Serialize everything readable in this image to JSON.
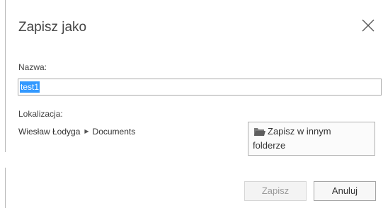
{
  "dialog": {
    "title": "Zapisz jako",
    "close_icon": "close-icon"
  },
  "name": {
    "label": "Nazwa:",
    "value": "test1",
    "selected": true
  },
  "location": {
    "label": "Lokalizacja:",
    "breadcrumb": [
      "Wiesław Łodyga",
      "Documents"
    ],
    "separator_icon": "chevron-right-icon"
  },
  "browse_button": {
    "icon": "folder-open-icon",
    "line1": "Zapisz w innym",
    "line2": "folderze"
  },
  "footer": {
    "save_label": "Zapisz",
    "save_enabled": false,
    "cancel_label": "Anuluj"
  },
  "colors": {
    "selection": "#3399ff",
    "folder": "#6b6b6b",
    "border": "#a9a9a9"
  }
}
